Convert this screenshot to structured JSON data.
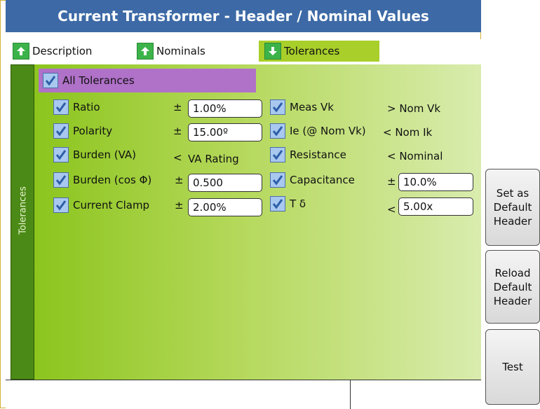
{
  "title": "Current Transformer - Header / Nominal Values",
  "tabs": [
    {
      "label": "Description",
      "icon": "arrow-up-icon"
    },
    {
      "label": "Nominals",
      "icon": "arrow-up-icon"
    },
    {
      "label": "Tolerances",
      "icon": "arrow-down-icon",
      "active": true
    }
  ],
  "side_label": "Tolerances",
  "all_tolerances": {
    "label": "All Tolerances",
    "checked": true
  },
  "left_items": [
    {
      "label": "Ratio",
      "symbol": "±",
      "value": "1.00%",
      "checked": true
    },
    {
      "label": "Polarity",
      "symbol": "±",
      "value": "15.00º",
      "checked": true
    },
    {
      "label": "Burden (VA)",
      "symbol": "<",
      "value": "VA Rating",
      "checked": true
    },
    {
      "label": "Burden (cos Φ)",
      "symbol": "±",
      "value": "0.500",
      "checked": true
    },
    {
      "label": "Current Clamp",
      "symbol": "±",
      "value": "2.00%",
      "checked": true
    }
  ],
  "right_items": [
    {
      "label": "Meas Vk",
      "text": "> Nom Vk",
      "checked": true
    },
    {
      "label": "Ie (@ Nom Vk)",
      "text": "< Nom Ik",
      "checked": true
    },
    {
      "label": "Resistance",
      "text": "< Nominal",
      "checked": true
    },
    {
      "label": "Capacitance",
      "symbol": "±",
      "value": "10.0%",
      "checked": true
    },
    {
      "label": "T δ",
      "symbol": "<",
      "value": "5.00x",
      "checked": true
    }
  ],
  "buttons": {
    "set_default": "Set as Default Header",
    "reload_default": "Reload Default Header",
    "test": "Test"
  },
  "colors": {
    "title_bar": "#3d6aa6",
    "active_tab": "#a8cf2a",
    "all_tol_bg": "#b071c8",
    "panel_green": "#8cc51e",
    "side_bar": "#4b8a16"
  }
}
